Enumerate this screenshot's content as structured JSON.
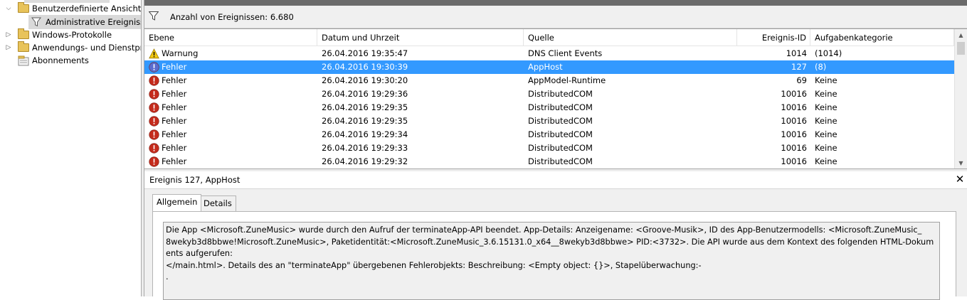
{
  "tree": {
    "items": [
      {
        "label": "Benutzerdefinierte Ansichten",
        "expander": "chevron-down"
      },
      {
        "label": "Administrative Ereignisse",
        "expander": ""
      },
      {
        "label": "Windows-Protokolle",
        "expander": "chevron-right"
      },
      {
        "label": "Anwendungs- und Dienstprotokolle",
        "expander": "chevron-right"
      },
      {
        "label": "Abonnements",
        "expander": ""
      }
    ]
  },
  "filter_bar": {
    "count_text": "Anzahl von Ereignissen: 6.680",
    "icon": "filter-icon"
  },
  "grid": {
    "columns": [
      "Ebene",
      "Datum und Uhrzeit",
      "Quelle",
      "Ereignis-ID",
      "Aufgabenkategorie"
    ],
    "rows": [
      {
        "level": "Warnung",
        "level_icon": "warning-icon",
        "datetime": "26.04.2016 19:35:47",
        "source": "DNS Client Events",
        "event_id": "1014",
        "category": "(1014)",
        "selected": false
      },
      {
        "level": "Fehler",
        "level_icon": "error-icon",
        "datetime": "26.04.2016 19:30:39",
        "source": "AppHost",
        "event_id": "127",
        "category": "(8)",
        "selected": true
      },
      {
        "level": "Fehler",
        "level_icon": "error-icon",
        "datetime": "26.04.2016 19:30:20",
        "source": "AppModel-Runtime",
        "event_id": "69",
        "category": "Keine",
        "selected": false
      },
      {
        "level": "Fehler",
        "level_icon": "error-icon",
        "datetime": "26.04.2016 19:29:36",
        "source": "DistributedCOM",
        "event_id": "10016",
        "category": "Keine",
        "selected": false
      },
      {
        "level": "Fehler",
        "level_icon": "error-icon",
        "datetime": "26.04.2016 19:29:35",
        "source": "DistributedCOM",
        "event_id": "10016",
        "category": "Keine",
        "selected": false
      },
      {
        "level": "Fehler",
        "level_icon": "error-icon",
        "datetime": "26.04.2016 19:29:35",
        "source": "DistributedCOM",
        "event_id": "10016",
        "category": "Keine",
        "selected": false
      },
      {
        "level": "Fehler",
        "level_icon": "error-icon",
        "datetime": "26.04.2016 19:29:34",
        "source": "DistributedCOM",
        "event_id": "10016",
        "category": "Keine",
        "selected": false
      },
      {
        "level": "Fehler",
        "level_icon": "error-icon",
        "datetime": "26.04.2016 19:29:33",
        "source": "DistributedCOM",
        "event_id": "10016",
        "category": "Keine",
        "selected": false
      },
      {
        "level": "Fehler",
        "level_icon": "error-icon",
        "datetime": "26.04.2016 19:29:32",
        "source": "DistributedCOM",
        "event_id": "10016",
        "category": "Keine",
        "selected": false
      }
    ]
  },
  "detail": {
    "title": "Ereignis 127, AppHost",
    "close_label": "✕",
    "tabs": [
      {
        "label": "Allgemein",
        "active": true
      },
      {
        "label": "Details",
        "active": false
      }
    ],
    "message": "Die App <Microsoft.ZuneMusic> wurde durch den Aufruf der terminateApp-API beendet. App-Details: Anzeigename: <Groove-Musik>, ID des App-Benutzermodells: <Microsoft.ZuneMusic_\n8wekyb3d8bbwe!Microsoft.ZuneMusic>, Paketidentität:<Microsoft.ZuneMusic_3.6.15131.0_x64__8wekyb3d8bbwe> PID:<3732>. Die API wurde aus dem Kontext des folgenden HTML-Dokuments aufgerufen:\n</main.html>. Details des an \"terminateApp\" übergebenen Fehlerobjekts: Beschreibung: <Empty object: {}>, Stapelüberwachung:-\n."
  },
  "colors": {
    "selection": "#3399ff",
    "error": "#c42b1c",
    "warning": "#f2c811"
  }
}
